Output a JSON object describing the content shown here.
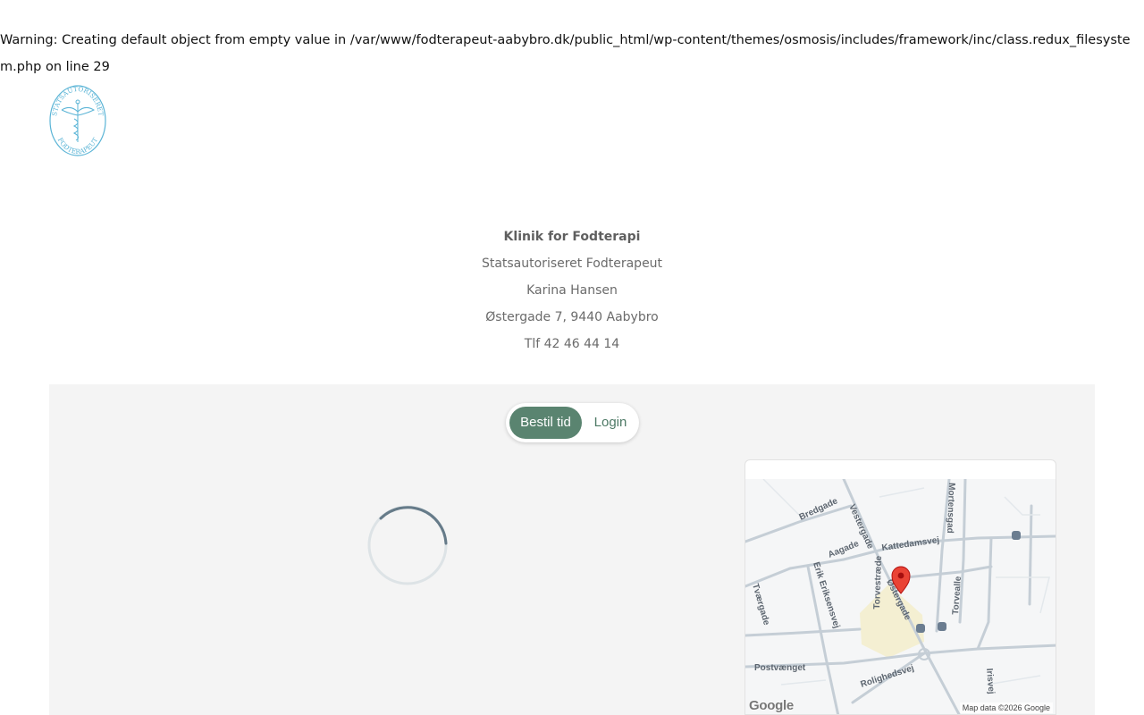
{
  "warning": {
    "text": "Warning: Creating default object from empty value in /var/www/fodterapeut-aabybro.dk/public_html/wp-content/themes/osmosis/includes/framework/inc/class.redux_filesystem.php on line 29"
  },
  "logo": {
    "top_text": "STATSAUTORISERET",
    "bottom_text": "FODTERAPEUT",
    "color": "#5ab4d6"
  },
  "clinic": {
    "name": "Klinik for Fodterapi",
    "subtitle": "Statsautoriseret Fodterapeut",
    "person": "Karina Hansen",
    "address": "Østergade 7, 9440 Aabybro",
    "phone": "Tlf 42 46 44 14"
  },
  "booking": {
    "book_label": "Bestil tid",
    "login_label": "Login",
    "accent": "#5a8470"
  },
  "map": {
    "streets": [
      "Bredgade",
      "Vestergade",
      "Mortensgad",
      "Aagade",
      "Kattedamsvej",
      "Erik Eriksensvej",
      "Torvestræde",
      "Torvealle",
      "Østergade",
      "Tværgade",
      "Postvænget",
      "Rolighedsvej",
      "Irisvej"
    ],
    "credit": "Map data ©2026 Google",
    "provider": "Google",
    "marker_color": "#ea4335"
  }
}
